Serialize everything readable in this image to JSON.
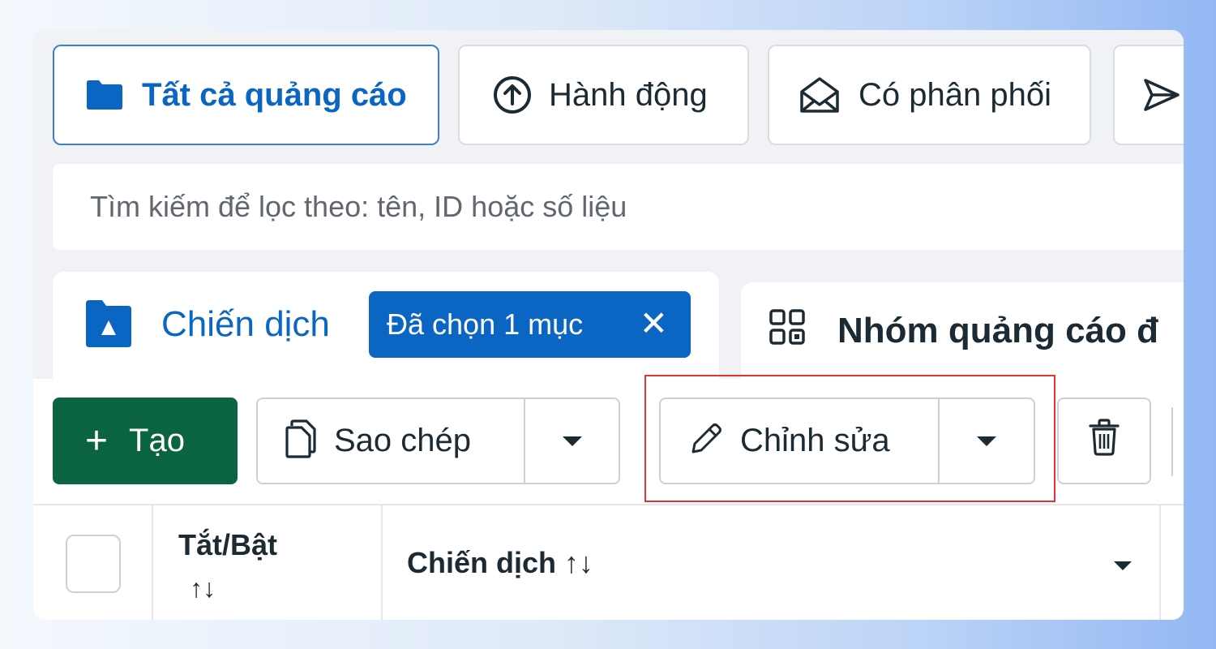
{
  "filters": [
    {
      "label": "Tất cả quảng cáo",
      "icon": "folder-icon",
      "active": true
    },
    {
      "label": "Hành động",
      "icon": "arrow-up-circle-icon",
      "active": false
    },
    {
      "label": "Có phân phối",
      "icon": "envelope-open-icon",
      "active": false
    },
    {
      "label": "",
      "icon": "send-icon",
      "active": false
    }
  ],
  "search": {
    "placeholder": "Tìm kiếm để lọc theo: tên, ID hoặc số liệu"
  },
  "tabs": {
    "campaign": {
      "label": "Chiến dịch",
      "selected_badge": "Đã chọn 1 mục",
      "clear_symbol": "✕"
    },
    "adset": {
      "label": "Nhóm quảng cáo đ"
    }
  },
  "toolbar": {
    "create_label": "Tạo",
    "create_symbol": "+",
    "duplicate_label": "Sao chép",
    "edit_label": "Chỉnh sửa"
  },
  "table": {
    "columns": [
      {
        "label": "Tắt/Bật",
        "sort": "↑↓"
      },
      {
        "label": "Chiến dịch ↑↓"
      }
    ]
  },
  "colors": {
    "accent": "#0a66c2",
    "create_button": "#0a6440",
    "highlight": "#e3342f"
  }
}
